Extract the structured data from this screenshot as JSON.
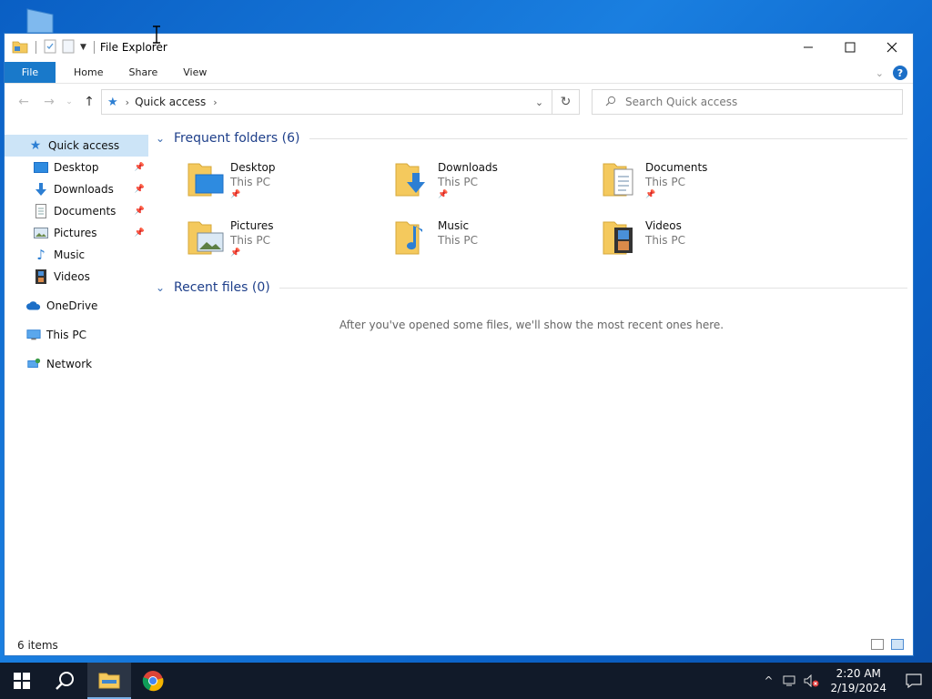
{
  "window": {
    "title": "File Explorer"
  },
  "ribbon": {
    "tabs": [
      {
        "label": "File"
      },
      {
        "label": "Home"
      },
      {
        "label": "Share"
      },
      {
        "label": "View"
      }
    ],
    "help": "?"
  },
  "navigation": {
    "address": "Quick access",
    "search_placeholder": "Search Quick access"
  },
  "sidebar": {
    "items": [
      {
        "label": "Quick access",
        "icon": "quick-access-star-icon",
        "active": true
      },
      {
        "label": "Desktop",
        "icon": "desktop-icon",
        "pinned": true
      },
      {
        "label": "Downloads",
        "icon": "download-arrow-icon",
        "pinned": true
      },
      {
        "label": "Documents",
        "icon": "document-icon",
        "pinned": true
      },
      {
        "label": "Pictures",
        "icon": "picture-icon",
        "pinned": true
      },
      {
        "label": "Music",
        "icon": "music-note-icon"
      },
      {
        "label": "Videos",
        "icon": "film-icon"
      },
      {
        "label": "OneDrive",
        "icon": "cloud-icon"
      },
      {
        "label": "This PC",
        "icon": "monitor-icon"
      },
      {
        "label": "Network",
        "icon": "network-icon"
      }
    ]
  },
  "main": {
    "frequent_header": "Frequent folders (6)",
    "folders": [
      {
        "name": "Desktop",
        "location": "This PC",
        "pinned": true
      },
      {
        "name": "Downloads",
        "location": "This PC",
        "pinned": true
      },
      {
        "name": "Documents",
        "location": "This PC",
        "pinned": true
      },
      {
        "name": "Pictures",
        "location": "This PC",
        "pinned": true
      },
      {
        "name": "Music",
        "location": "This PC",
        "pinned": false
      },
      {
        "name": "Videos",
        "location": "This PC",
        "pinned": false
      }
    ],
    "recent_header": "Recent files (0)",
    "recent_empty": "After you've opened some files, we'll show the most recent ones here."
  },
  "status": {
    "items": "6 items"
  },
  "taskbar": {
    "time": "2:20 AM",
    "date": "2/19/2024"
  },
  "colors": {
    "accent": "#1979ca",
    "selection": "#cce4f7",
    "folder": "#f4c95d",
    "header_text": "#1e3f8a"
  }
}
